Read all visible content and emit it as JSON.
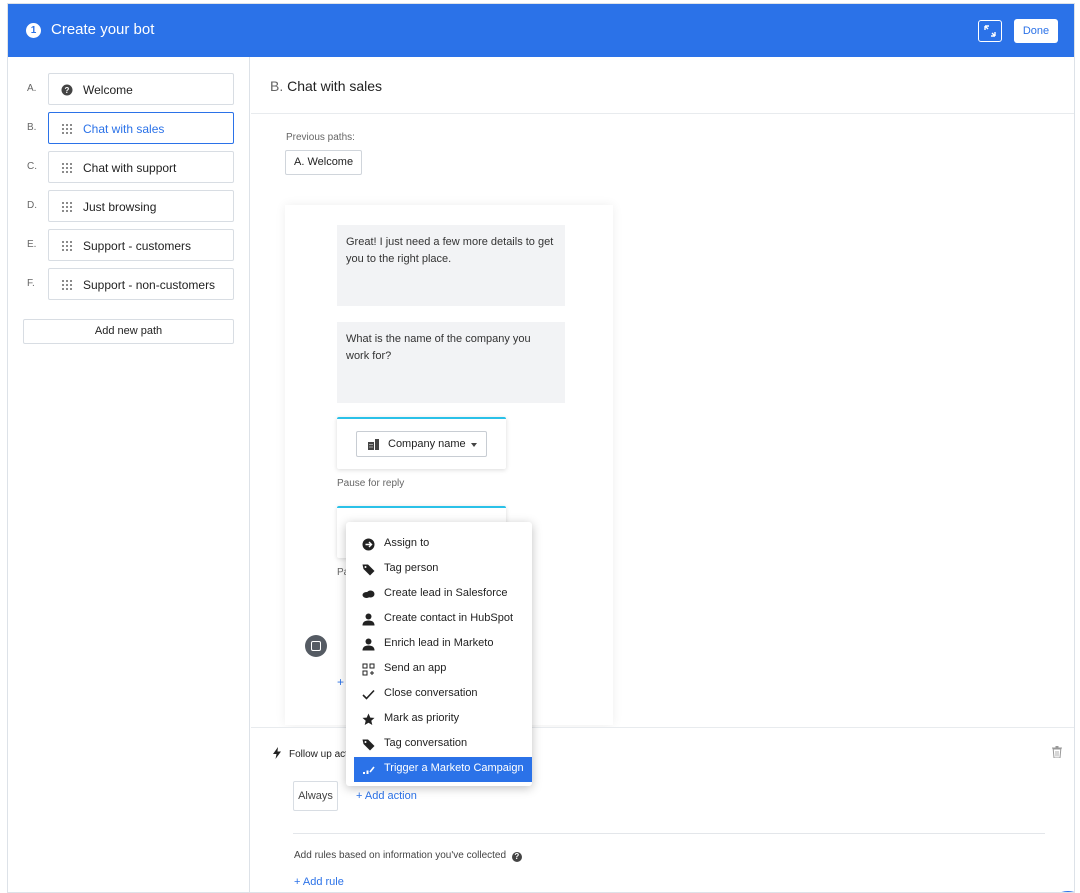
{
  "header": {
    "step_number": "1",
    "title": "Create your bot",
    "done_label": "Done"
  },
  "sidebar": {
    "items": [
      {
        "letter": "A.",
        "label": "Welcome",
        "icon": "question-circle-icon"
      },
      {
        "letter": "B.",
        "label": "Chat with sales",
        "icon": "drag-handle-icon",
        "active": true
      },
      {
        "letter": "C.",
        "label": "Chat with support",
        "icon": "drag-handle-icon"
      },
      {
        "letter": "D.",
        "label": "Just browsing",
        "icon": "drag-handle-icon"
      },
      {
        "letter": "E.",
        "label": "Support - customers",
        "icon": "drag-handle-icon"
      },
      {
        "letter": "F.",
        "label": "Support - non-customers",
        "icon": "drag-handle-icon"
      }
    ],
    "add_path_label": "Add new path"
  },
  "main": {
    "path_prefix": "B.",
    "path_title": "Chat with sales",
    "previous_paths_label": "Previous paths:",
    "previous_paths": [
      "A. Welcome"
    ],
    "messages": [
      "Great! I just need a few more details to get you to the right place.",
      "What is the name of the company you work for?"
    ],
    "attribute_select": "Company name",
    "pause_label": "Pause for reply",
    "pause_label_partial": "Pa",
    "add_plus": "+",
    "follow_up_label": "Follow up act",
    "always_label": "Always",
    "add_action_label": "+  Add action",
    "rules_text": "Add rules based on information you've collected",
    "add_rule_label": "+  Add rule"
  },
  "menu": {
    "items": [
      {
        "label": "Assign to",
        "icon": "assign-icon"
      },
      {
        "label": "Tag person",
        "icon": "tag-icon"
      },
      {
        "label": "Create lead in Salesforce",
        "icon": "salesforce-cloud-icon"
      },
      {
        "label": "Create contact in HubSpot",
        "icon": "person-icon"
      },
      {
        "label": "Enrich lead in Marketo",
        "icon": "person-icon"
      },
      {
        "label": "Send an app",
        "icon": "app-grid-icon"
      },
      {
        "label": "Close conversation",
        "icon": "checkmark-icon"
      },
      {
        "label": "Mark as priority",
        "icon": "star-icon"
      },
      {
        "label": "Tag conversation",
        "icon": "tag-icon"
      },
      {
        "label": "Trigger a Marketo Campaign",
        "icon": "marketo-chart-icon",
        "selected": true
      }
    ]
  },
  "colors": {
    "accent": "#2b72e8",
    "card_border_accent": "#2ac1e8",
    "message_bg": "#f2f3f5"
  }
}
